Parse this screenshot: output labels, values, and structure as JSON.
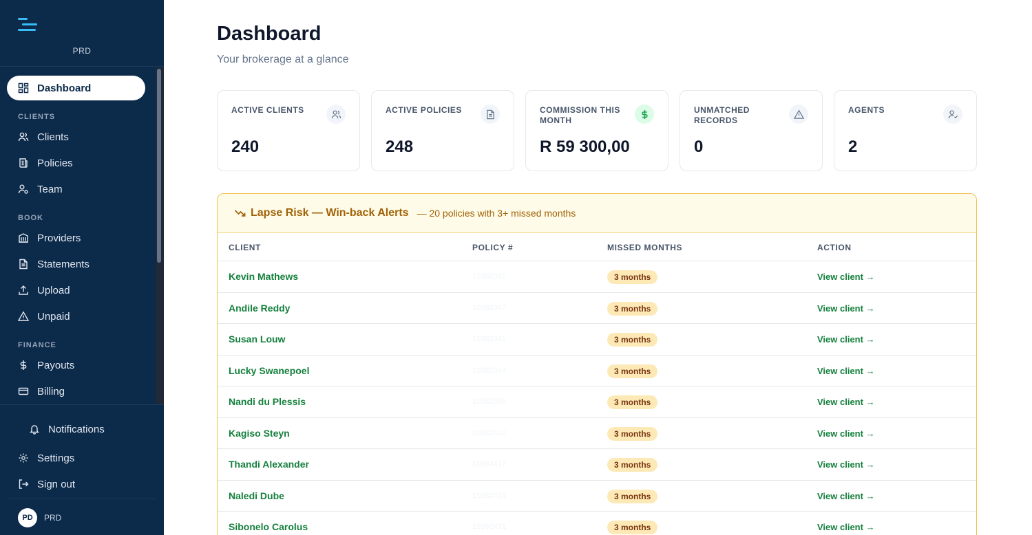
{
  "sidebar": {
    "org": "PRD",
    "active": {
      "label": "Dashboard",
      "icon": "dashboard-icon"
    },
    "sections": [
      {
        "title": "CLIENTS",
        "items": [
          {
            "label": "Clients",
            "icon": "users-icon"
          },
          {
            "label": "Policies",
            "icon": "policies-icon"
          },
          {
            "label": "Team",
            "icon": "team-icon"
          }
        ]
      },
      {
        "title": "BOOK",
        "items": [
          {
            "label": "Providers",
            "icon": "building-icon"
          },
          {
            "label": "Statements",
            "icon": "document-icon"
          },
          {
            "label": "Upload",
            "icon": "upload-icon"
          },
          {
            "label": "Unpaid",
            "icon": "warning-icon"
          }
        ]
      },
      {
        "title": "FINANCE",
        "items": [
          {
            "label": "Payouts",
            "icon": "dollar-icon"
          },
          {
            "label": "Billing",
            "icon": "card-icon"
          }
        ]
      }
    ],
    "bottom": {
      "notifications": "Notifications",
      "settings": "Settings",
      "signout": "Sign out"
    },
    "user": {
      "initials": "PD",
      "name": "PRD"
    }
  },
  "header": {
    "title": "Dashboard",
    "subtitle": "Your brokerage at a glance"
  },
  "stats": [
    {
      "label": "ACTIVE CLIENTS",
      "value": "240",
      "icon": "users-icon"
    },
    {
      "label": "ACTIVE POLICIES",
      "value": "248",
      "icon": "document-icon"
    },
    {
      "label": "COMMISSION THIS MONTH",
      "value": "R 59 300,00",
      "icon": "dollar-icon"
    },
    {
      "label": "UNMATCHED RECORDS",
      "value": "0",
      "icon": "warning-icon"
    },
    {
      "label": "AGENTS",
      "value": "2",
      "icon": "user-check-icon"
    }
  ],
  "alert": {
    "title": "Lapse Risk — Win-back Alerts",
    "subtitle": "— 20 policies with 3+ missed months",
    "columns": [
      "CLIENT",
      "POLICY #",
      "MISSED MONTHS",
      "ACTION"
    ],
    "rows": [
      {
        "client": "Kevin Mathews",
        "policy": "10382342",
        "missed": "3 months",
        "action": "View client →"
      },
      {
        "client": "Andile Reddy",
        "policy": "10382367",
        "missed": "3 months",
        "action": "View client →"
      },
      {
        "client": "Susan Louw",
        "policy": "10382381",
        "missed": "3 months",
        "action": "View client →"
      },
      {
        "client": "Lucky Swanepoel",
        "policy": "10382384",
        "missed": "3 months",
        "action": "View client →"
      },
      {
        "client": "Nandi du Plessis",
        "policy": "10382389",
        "missed": "3 months",
        "action": "View client →"
      },
      {
        "client": "Kagiso Steyn",
        "policy": "10382402",
        "missed": "3 months",
        "action": "View client →"
      },
      {
        "client": "Thandi Alexander",
        "policy": "10382417",
        "missed": "3 months",
        "action": "View client →"
      },
      {
        "client": "Naledi Dube",
        "policy": "10382424",
        "missed": "3 months",
        "action": "View client →"
      },
      {
        "client": "Sibonelo Carolus",
        "policy": "10382431",
        "missed": "3 months",
        "action": "View client →"
      }
    ]
  },
  "colors": {
    "sidebar": "#0c2a4a",
    "accent": "#15803d",
    "warning": "#a16207"
  }
}
